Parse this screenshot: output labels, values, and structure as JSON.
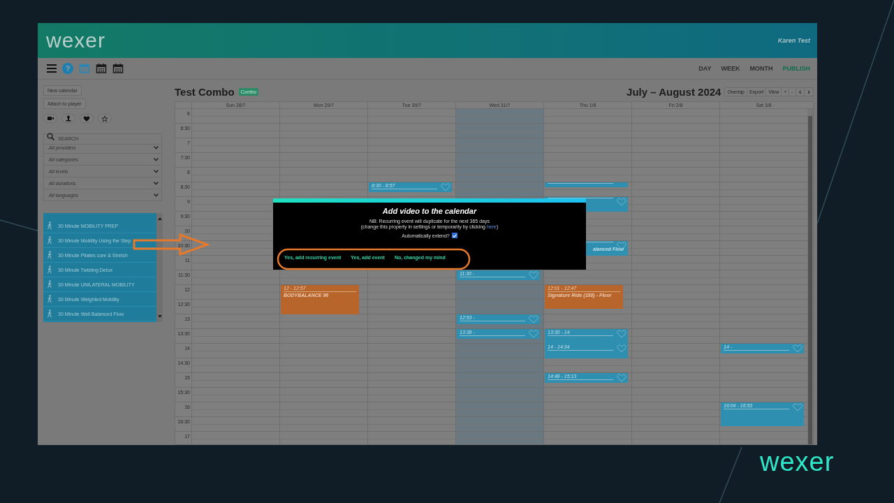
{
  "slide": {
    "logo": "wexer"
  },
  "header": {
    "logo": "wexer",
    "user": "Karen Test"
  },
  "toolbar": {
    "help": "?"
  },
  "views": [
    {
      "label": "DAY",
      "selected": false
    },
    {
      "label": "WEEK",
      "selected": false
    },
    {
      "label": "MONTH",
      "selected": false
    },
    {
      "label": "PUBLISH",
      "selected": true
    }
  ],
  "sidebar": {
    "buttons": [
      "New calendar",
      "Attach to player"
    ],
    "search": {
      "placeholder": "SEARCH"
    },
    "filters": [
      "All providers",
      "All categories",
      "All levels",
      "All durations",
      "All languages"
    ],
    "videos": [
      "30 Minute MOBILITY PREP",
      "30 Minute Mobility Using the Step",
      "30 Minute Pilates core & Stretch",
      "30 Minute Twisting Detox",
      "30 Minute UNILATERAL MOBILITY",
      "30 Minute Weighted Mobility",
      "30 Minute Well Balanced Flow"
    ]
  },
  "calendar": {
    "title": "Test Combo",
    "badge": "Combo",
    "range": "July – August 2024",
    "controls": [
      "Overlap",
      "Export",
      "View",
      "+",
      "-",
      "‹",
      "›"
    ],
    "days": [
      {
        "label": "Sun 28/7",
        "selected": false
      },
      {
        "label": "Mon 29/7",
        "selected": false
      },
      {
        "label": "Tue 30/7",
        "selected": false
      },
      {
        "label": "Wed 31/7",
        "selected": true
      },
      {
        "label": "Thu 1/8",
        "selected": false
      },
      {
        "label": "Fri 2/8",
        "selected": false
      },
      {
        "label": "Sat 3/8",
        "selected": false
      }
    ],
    "slots": [
      {
        "time": "6"
      },
      {
        "time": "6:30"
      },
      {
        "time": "7"
      },
      {
        "time": "7:30"
      },
      {
        "time": "8"
      },
      {
        "time": "8:30",
        "cells": [
          null,
          null,
          {
            "kind": "video-short",
            "time": "8:30 - 8:57"
          },
          null,
          {
            "kind": "video-thin"
          },
          null,
          null
        ]
      },
      {
        "time": "9",
        "cells": [
          null,
          null,
          null,
          null,
          {
            "kind": "video-half"
          },
          null,
          null
        ]
      },
      {
        "time": "9:30"
      },
      {
        "time": "10"
      },
      {
        "time": "10:30",
        "cells": [
          null,
          null,
          null,
          null,
          {
            "kind": "video-half",
            "title": "alanced Flow"
          },
          null,
          null
        ]
      },
      {
        "time": "11"
      },
      {
        "time": "11:30",
        "cells": [
          null,
          null,
          null,
          {
            "kind": "video-short",
            "time": "11:30 -"
          },
          null,
          null,
          null
        ]
      },
      {
        "time": "12",
        "cells": [
          null,
          {
            "kind": "class-hour",
            "time": "12 - 12:57",
            "title": "BODYBALANCE 96"
          },
          null,
          null,
          {
            "kind": "class-long",
            "time": "12:01 - 12:47",
            "title": "Signature Ride (188) - Floor"
          },
          null,
          null
        ]
      },
      {
        "time": "12:30"
      },
      {
        "time": "13",
        "cells": [
          null,
          null,
          null,
          {
            "kind": "video-short",
            "time": "12:53 -"
          },
          null,
          null,
          null
        ]
      },
      {
        "time": "13:30",
        "cells": [
          null,
          null,
          null,
          {
            "kind": "video-short",
            "time": "13:38 -"
          },
          {
            "kind": "video-half",
            "time": "13:30 - 14"
          },
          null,
          null
        ]
      },
      {
        "time": "14",
        "cells": [
          null,
          null,
          null,
          null,
          {
            "kind": "video-half",
            "time": "14 - 14:34"
          },
          null,
          {
            "kind": "video-short",
            "time": "14 -"
          }
        ]
      },
      {
        "time": "14:30"
      },
      {
        "time": "15",
        "cells": [
          null,
          null,
          null,
          null,
          {
            "kind": "video-short",
            "time": "14:48 - 15:13"
          },
          null,
          null
        ]
      },
      {
        "time": "15:30"
      },
      {
        "time": "16",
        "cells": [
          null,
          null,
          null,
          null,
          null,
          null,
          {
            "kind": "video-long",
            "time": "16:04 - 16:53"
          }
        ]
      },
      {
        "time": "16:30"
      },
      {
        "time": "17"
      }
    ]
  },
  "modal": {
    "title": "Add video to the calendar",
    "note": "NB: Recurring event will duplicate for the next 365 days",
    "hint": "(change this property in settings or temporarily by clicking ",
    "hint_link": "here",
    "hint_end": ")",
    "auto_extend": {
      "label": "Automatically extend?",
      "checked": true
    },
    "buttons": [
      "Yes, add recurring event",
      "Yes, add event",
      "No, changed my mind"
    ]
  }
}
